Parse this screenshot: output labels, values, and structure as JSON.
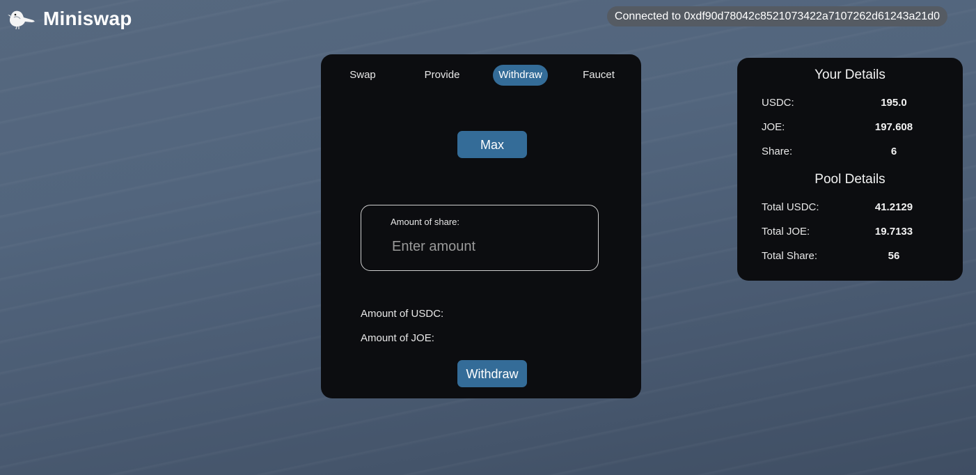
{
  "brand": {
    "name": "Miniswap",
    "logo_icon": "bird-logo-icon"
  },
  "wallet": {
    "status_text": "Connected to 0xdf90d78042c8521073422a7107262d61243a21d0"
  },
  "tabs": [
    {
      "label": "Swap",
      "active": false
    },
    {
      "label": "Provide",
      "active": false
    },
    {
      "label": "Withdraw",
      "active": true
    },
    {
      "label": "Faucet",
      "active": false
    }
  ],
  "withdraw_form": {
    "max_label": "Max",
    "amount_label": "Amount of share:",
    "amount_value": "",
    "amount_placeholder": "Enter amount",
    "usdc_result_label": "Amount of USDC:",
    "joe_result_label": "Amount of JOE:",
    "submit_label": "Withdraw"
  },
  "your_details": {
    "title": "Your Details",
    "rows": [
      {
        "label": "USDC:",
        "value": "195.0"
      },
      {
        "label": "JOE:",
        "value": "197.608"
      },
      {
        "label": "Share:",
        "value": "6"
      }
    ]
  },
  "pool_details": {
    "title": "Pool Details",
    "rows": [
      {
        "label": "Total USDC:",
        "value": "41.2129"
      },
      {
        "label": "Total JOE:",
        "value": "19.7133"
      },
      {
        "label": "Total Share:",
        "value": "56"
      }
    ]
  },
  "colors": {
    "accent": "#346c98",
    "card_background": "#0c0d10",
    "pill_background": "#555b63"
  }
}
